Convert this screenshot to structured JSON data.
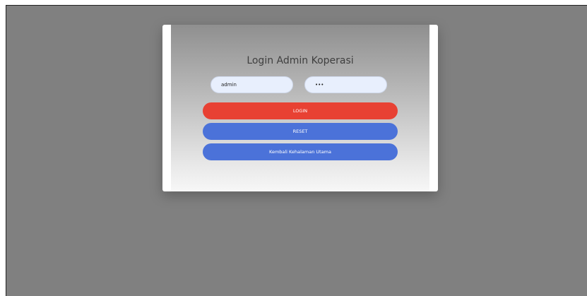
{
  "login": {
    "title": "Login Admin Koperasi",
    "username_value": "admin",
    "password_value": "•••",
    "login_label": "LOGIN",
    "reset_label": "RESET",
    "back_label": "Kembali Kehalaman Utama"
  },
  "colors": {
    "login_button": "#e84133",
    "reset_button": "#4b72d9",
    "back_button": "#4b72d9",
    "input_bg": "#e8effd",
    "page_bg": "#808080"
  }
}
